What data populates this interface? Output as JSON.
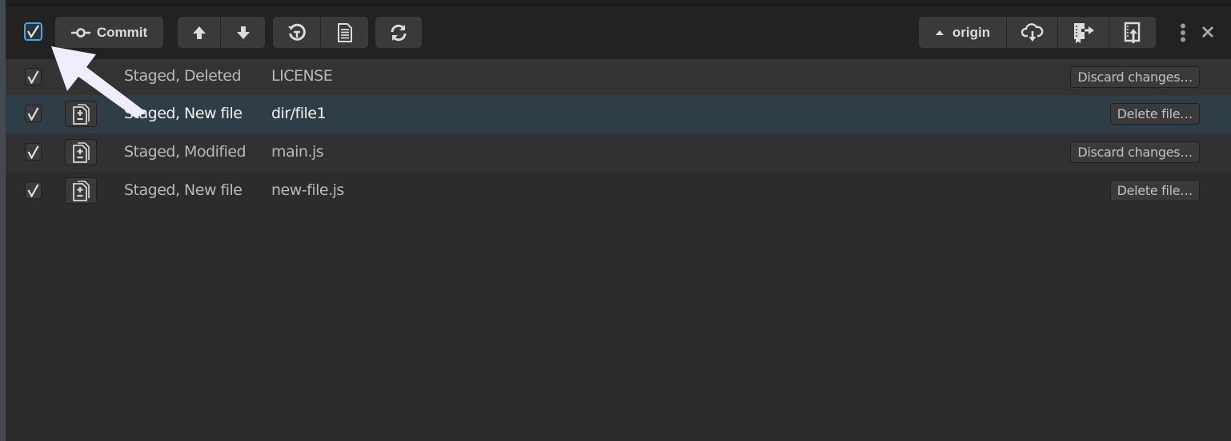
{
  "toolbar": {
    "select_all_checked": true,
    "commit_label": "Commit",
    "push_pull_group": [
      {
        "icon": "arrow-up-icon",
        "label": "Push"
      },
      {
        "icon": "arrow-down-icon",
        "label": "Pull"
      }
    ],
    "history_group": [
      {
        "icon": "history-icon",
        "label": "History"
      },
      {
        "icon": "document-icon",
        "label": "Log"
      }
    ],
    "refresh_icon": "refresh-icon",
    "remote": {
      "caret_icon": "caret-up-icon",
      "label": "origin"
    },
    "remote_actions": [
      {
        "icon": "cloud-download-icon",
        "label": "Fetch"
      },
      {
        "icon": "book-export-icon",
        "label": "Export"
      },
      {
        "icon": "book-upload-icon",
        "label": "Upload"
      }
    ],
    "more_icon": "kebab-menu-icon",
    "close_icon": "close-icon"
  },
  "files": [
    {
      "checked": true,
      "has_icon": false,
      "status": "Staged, Deleted",
      "path": "LICENSE",
      "action": "Discard changes…",
      "selected": false
    },
    {
      "checked": true,
      "has_icon": true,
      "status": "Staged, New file",
      "path": "dir/file1",
      "action": "Delete file…",
      "selected": true
    },
    {
      "checked": true,
      "has_icon": true,
      "status": "Staged, Modified",
      "path": "main.js",
      "action": "Discard changes…",
      "selected": false
    },
    {
      "checked": true,
      "has_icon": true,
      "status": "Staged, New file",
      "path": "new-file.js",
      "action": "Delete file…",
      "selected": false
    }
  ],
  "colors": {
    "accent": "#4aa3e0",
    "selected_row": "#2f3e46",
    "row_odd": "#333333",
    "row_even": "#2e2e2e",
    "toolbar_bg": "#222222",
    "button_bg": "#3a3a3a"
  }
}
